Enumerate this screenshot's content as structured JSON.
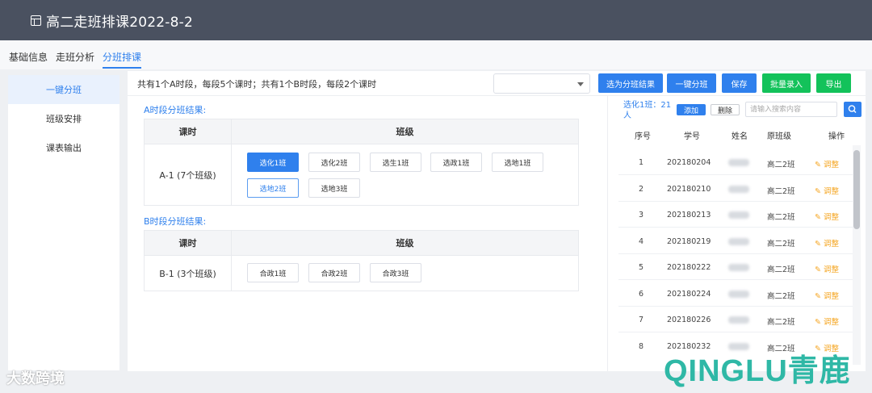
{
  "header": {
    "title": "高二走班排课2022-8-2"
  },
  "topnav": {
    "tabs": [
      "基础信息",
      "走班分析",
      "分班排课"
    ]
  },
  "sidebar": {
    "items": [
      "一键分班",
      "班级安排",
      "课表输出"
    ]
  },
  "toolbar": {
    "info": "共有1个A时段，每段5个课时；共有1个B时段，每段2个课时",
    "select_value": "",
    "buttons": [
      "选为分班结果",
      "一键分班",
      "保存",
      "批量录入",
      "导出"
    ]
  },
  "section_a": {
    "title": "A时段分班结果:",
    "col_period": "课时",
    "col_class": "班级",
    "period": "A-1 (7个班级)",
    "classes": [
      "选化1班",
      "选化2班",
      "选生1班",
      "选政1班",
      "选地1班",
      "选地2班",
      "选地3班"
    ]
  },
  "section_b": {
    "title": "B时段分班结果:",
    "col_period": "课时",
    "col_class": "班级",
    "period": "B-1 (3个班级)",
    "classes": [
      "合政1班",
      "合政2班",
      "合政3班"
    ]
  },
  "right_panel": {
    "label": "选化1班：21人",
    "add": "添加",
    "delete": "删除",
    "search_placeholder": "请输入搜索内容",
    "headers": [
      "序号",
      "学号",
      "姓名",
      "原班级",
      "操作"
    ],
    "rows": [
      {
        "no": "1",
        "id": "202180204",
        "cls": "高二2班",
        "op": "调整"
      },
      {
        "no": "2",
        "id": "202180210",
        "cls": "高二2班",
        "op": "调整"
      },
      {
        "no": "3",
        "id": "202180213",
        "cls": "高二2班",
        "op": "调整"
      },
      {
        "no": "4",
        "id": "202180219",
        "cls": "高二2班",
        "op": "调整"
      },
      {
        "no": "5",
        "id": "202180222",
        "cls": "高二2班",
        "op": "调整"
      },
      {
        "no": "6",
        "id": "202180224",
        "cls": "高二2班",
        "op": "调整"
      },
      {
        "no": "7",
        "id": "202180226",
        "cls": "高二2班",
        "op": "调整"
      },
      {
        "no": "8",
        "id": "202180232",
        "cls": "高二2班",
        "op": "调整"
      }
    ]
  },
  "watermarks": {
    "left": "大数跨境",
    "right": "QINGLU青鹿"
  },
  "colors": {
    "accent": "#2f80ed",
    "success": "#13c25a",
    "warning": "#f5a623",
    "header_bg": "#4a5160"
  }
}
